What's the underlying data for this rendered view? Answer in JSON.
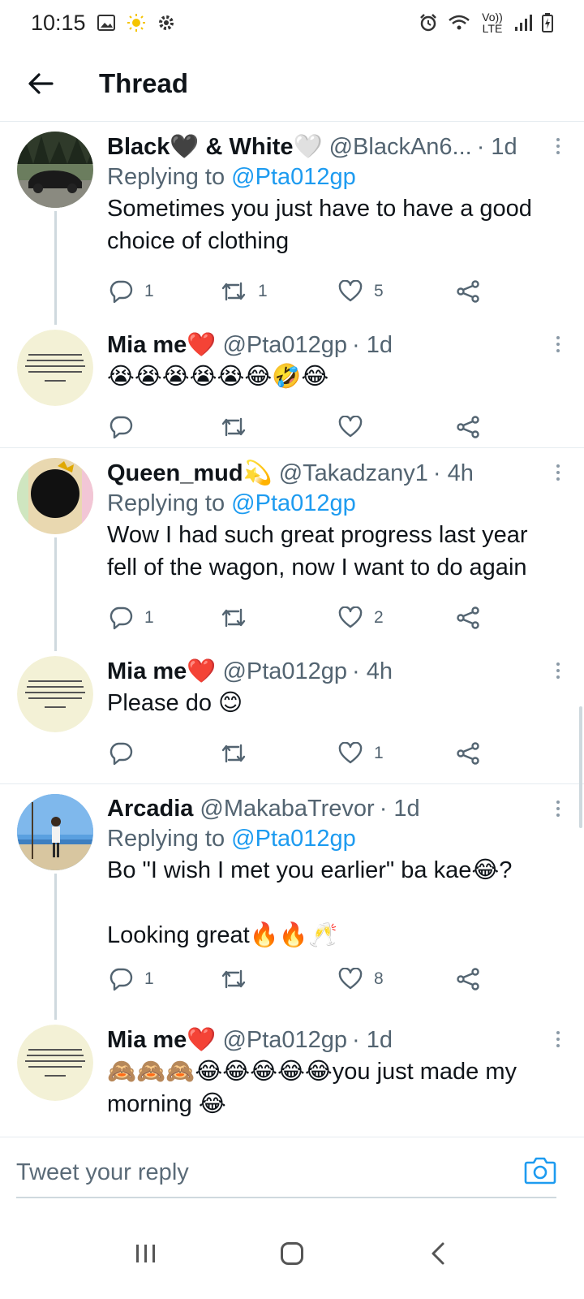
{
  "status_bar": {
    "time": "10:15",
    "lte_label": "Vo)) LTE"
  },
  "header": {
    "title": "Thread"
  },
  "tweets": [
    {
      "name": "Black🖤 & White🤍",
      "handle": "@BlackAn6...",
      "time": "· 1d",
      "reply_prefix": "Replying to ",
      "reply_handle": "@Pta012gp",
      "text": "Sometimes you just have to have a good choice of clothing",
      "replies": "1",
      "retweets": "1",
      "likes": "5"
    },
    {
      "name": "Mia me❤️",
      "handle": "@Pta012gp",
      "time": "· 1d",
      "text": "😭😭😭😭😭😂🤣😂",
      "replies": "",
      "retweets": "",
      "likes": ""
    },
    {
      "name": "Queen_mud💫",
      "handle": "@Takadzany1",
      "time": "· 4h",
      "reply_prefix": "Replying to ",
      "reply_handle": "@Pta012gp",
      "text": "Wow I had such great progress last year fell of the wagon, now I want to do again",
      "replies": "1",
      "retweets": "",
      "likes": "2"
    },
    {
      "name": "Mia me❤️",
      "handle": "@Pta012gp",
      "time": "· 4h",
      "text": "Please do 😊",
      "replies": "",
      "retweets": "",
      "likes": "1"
    },
    {
      "name": "Arcadia",
      "handle": "@MakabaTrevor",
      "time": "· 1d",
      "reply_prefix": "Replying to ",
      "reply_handle": "@Pta012gp",
      "text": "Bo \"I wish I met you earlier\" ba kae😂?\n\nLooking great🔥🔥🥂",
      "replies": "1",
      "retweets": "",
      "likes": "8"
    },
    {
      "name": "Mia me❤️",
      "handle": "@Pta012gp",
      "time": "· 1d",
      "text": "🙈🙈🙈😂😂😂😂😂you just made my morning 😂"
    }
  ],
  "composer": {
    "placeholder": "Tweet your reply"
  },
  "icons": {
    "back": "arrow-left-icon",
    "reply": "speech-bubble-icon",
    "retweet": "retweet-icon",
    "like": "heart-icon",
    "share": "share-icon",
    "camera": "camera-icon"
  },
  "colors": {
    "accent": "#1d9bf0",
    "secondary_text": "#536471",
    "divider": "#e6ecf0"
  }
}
